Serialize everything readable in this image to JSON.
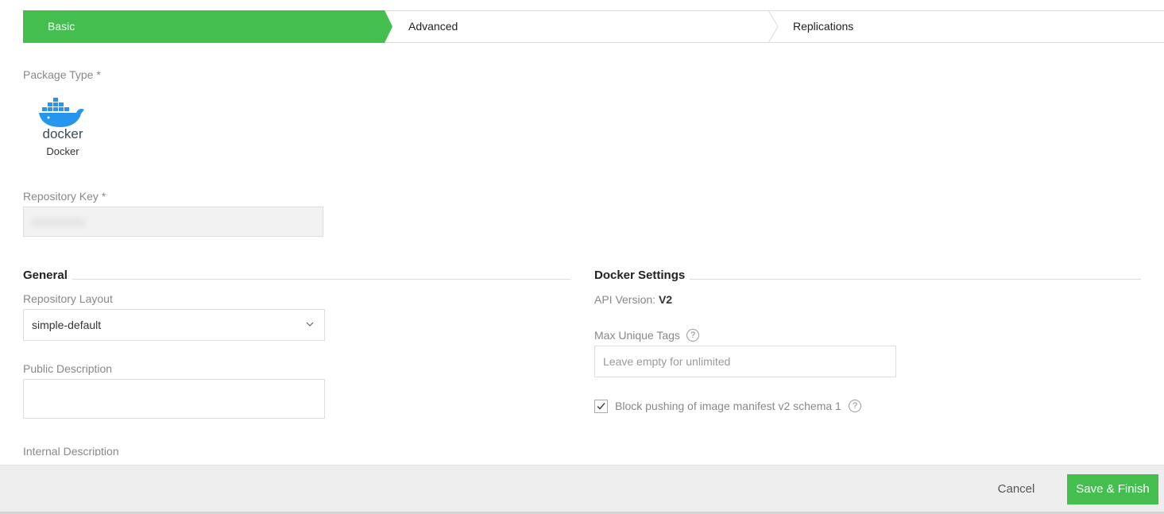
{
  "wizard": {
    "steps": [
      {
        "label": "Basic",
        "active": true
      },
      {
        "label": "Advanced",
        "active": false
      },
      {
        "label": "Replications",
        "active": false
      }
    ],
    "active_color": "#43be4f"
  },
  "package_type": {
    "label": "Package Type *",
    "selected": "Docker",
    "icon": "docker-logo-icon",
    "logo_text": "docker"
  },
  "repository_key": {
    "label": "Repository Key *"
  },
  "general": {
    "title": "General",
    "repository_layout_label": "Repository Layout",
    "repository_layout_value": "simple-default",
    "public_description_label": "Public Description",
    "internal_description_label": "Internal Description"
  },
  "docker_settings": {
    "title": "Docker Settings",
    "api_version_label": "API Version:",
    "api_version_value": "V2",
    "max_unique_tags_label": "Max Unique Tags",
    "max_unique_tags_placeholder": "Leave empty for unlimited",
    "block_pushing_label": "Block pushing of image manifest v2 schema 1",
    "block_pushing_checked": true,
    "help_glyph": "?"
  },
  "footer": {
    "cancel_label": "Cancel",
    "save_label": "Save & Finish"
  }
}
